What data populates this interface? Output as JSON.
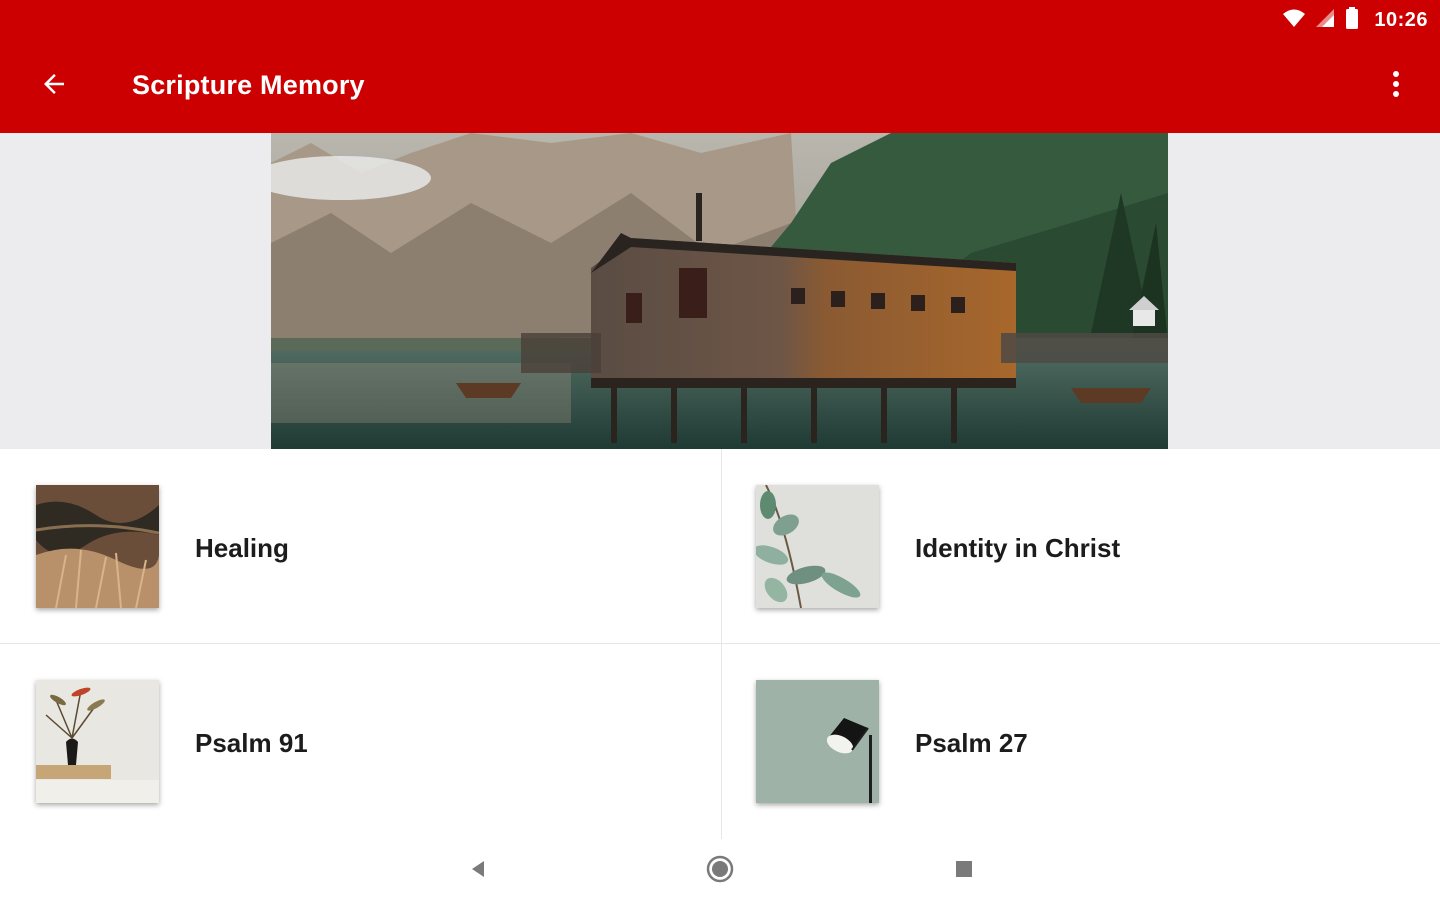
{
  "status_bar": {
    "time": "10:26",
    "icons": [
      "wifi-icon",
      "signal-icon",
      "battery-icon"
    ]
  },
  "app_bar": {
    "title": "Scripture Memory",
    "back_icon": "arrow-left-icon",
    "menu_icon": "more-vert-icon",
    "color": "#cc0000"
  },
  "banner": {
    "subject": "mountain lake boathouse"
  },
  "topics": [
    {
      "label": "Healing",
      "thumb": "dry-grass-thumbnail"
    },
    {
      "label": "Identity in Christ",
      "thumb": "eucalyptus-leaves-thumbnail"
    },
    {
      "label": "Psalm 91",
      "thumb": "vase-flowers-thumbnail"
    },
    {
      "label": "Psalm 27",
      "thumb": "wall-lamp-thumbnail"
    }
  ],
  "nav_bar": {
    "icons": [
      "back-triangle-icon",
      "home-circle-icon",
      "recents-square-icon"
    ]
  }
}
